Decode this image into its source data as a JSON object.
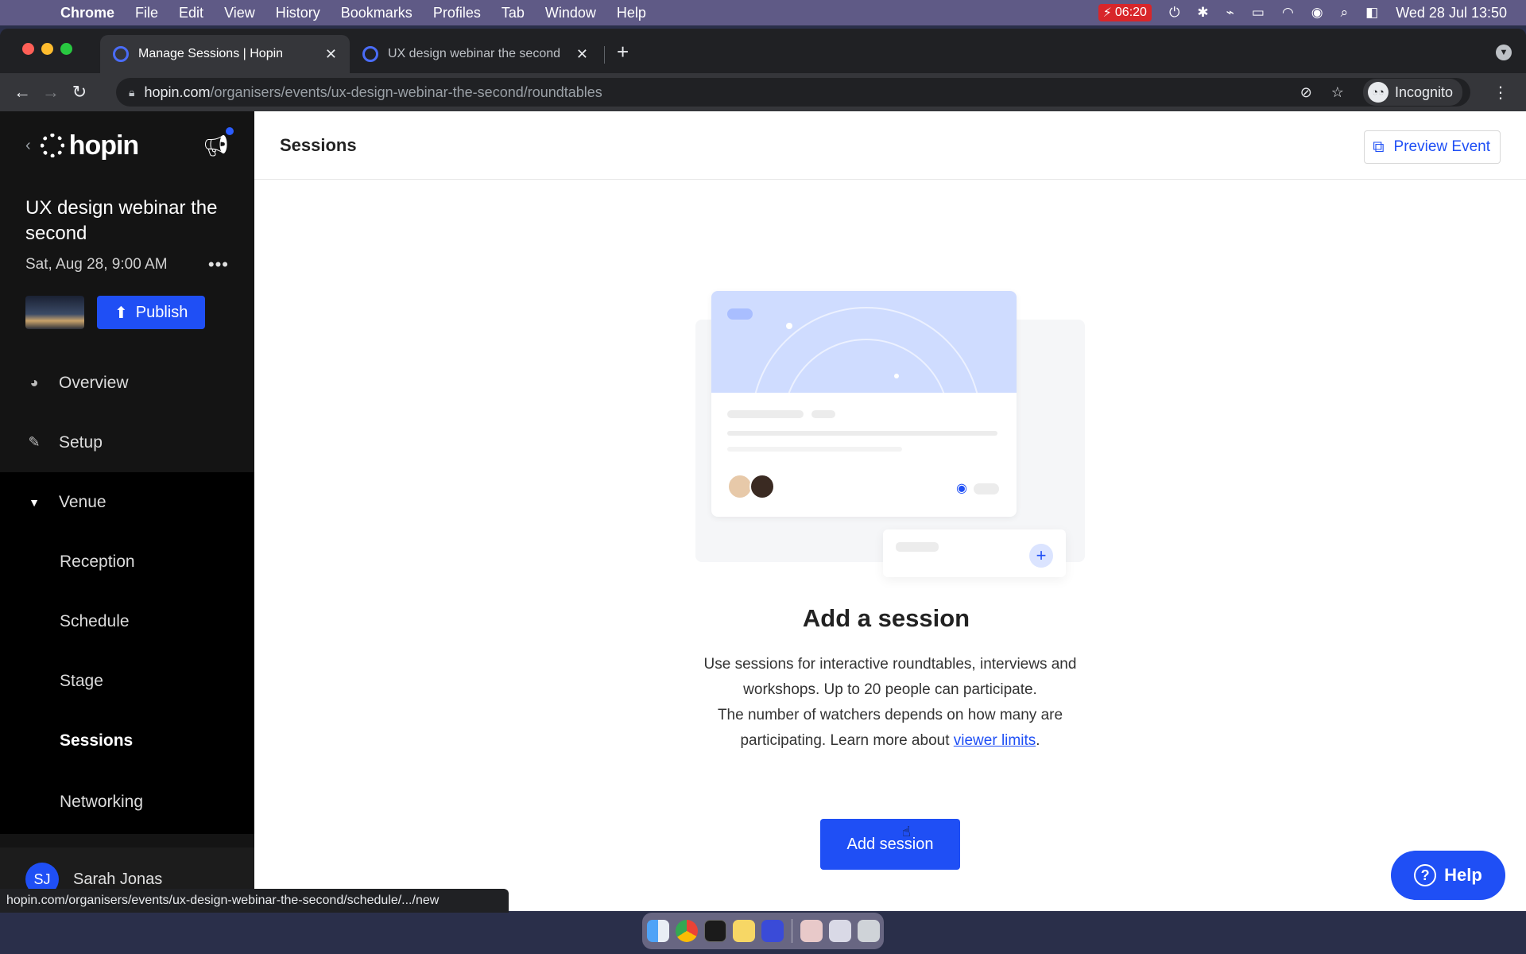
{
  "menubar": {
    "app": "Chrome",
    "items": [
      "File",
      "Edit",
      "View",
      "History",
      "Bookmarks",
      "Profiles",
      "Tab",
      "Window",
      "Help"
    ],
    "battery_time": "06:20",
    "datetime": "Wed 28 Jul  13:50"
  },
  "browser": {
    "tabs": [
      {
        "title": "Manage Sessions | Hopin",
        "active": true
      },
      {
        "title": "UX design webinar the second",
        "active": false
      }
    ],
    "url_host": "hopin.com",
    "url_path": "/organisers/events/ux-design-webinar-the-second/roundtables",
    "profile_label": "Incognito",
    "status_url": "hopin.com/organisers/events/ux-design-webinar-the-second/schedule/.../new"
  },
  "sidebar": {
    "logo": "hopin",
    "event_title": "UX design webinar the second",
    "event_date": "Sat, Aug 28, 9:00 AM",
    "publish_label": "Publish",
    "nav": {
      "overview": "Overview",
      "setup": "Setup",
      "venue": "Venue",
      "reception": "Reception",
      "schedule": "Schedule",
      "stage": "Stage",
      "sessions": "Sessions",
      "networking": "Networking"
    },
    "user": {
      "initials": "SJ",
      "name": "Sarah Jonas"
    }
  },
  "main": {
    "title": "Sessions",
    "preview_label": "Preview Event",
    "empty_title": "Add a session",
    "desc1": "Use sessions for interactive roundtables, interviews and workshops. Up to 20 people can participate.",
    "desc2_prefix": "The number of watchers depends on how many are participating. Learn more about ",
    "desc2_link": "viewer limits",
    "desc2_suffix": ".",
    "add_label": "Add session",
    "help_label": "Help"
  },
  "colors": {
    "accent": "#1f4ff5",
    "sidebar_bg": "#141414",
    "venue_bg": "#000000"
  }
}
